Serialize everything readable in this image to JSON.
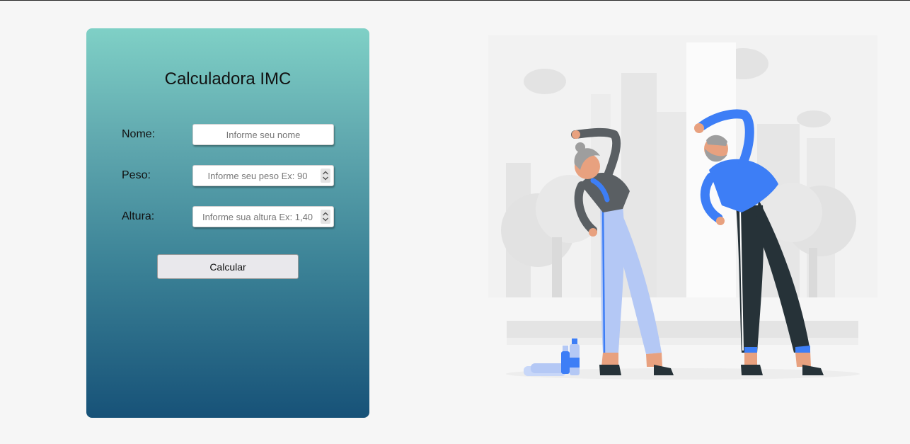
{
  "form": {
    "title": "Calculadora IMC",
    "name_label": "Nome:",
    "name_placeholder": "Informe seu nome",
    "weight_label": "Peso:",
    "weight_placeholder": "Informe seu peso Ex: 90",
    "height_label": "Altura:",
    "height_placeholder": "Informe sua altura Ex: 1,40",
    "submit_label": "Calcular"
  },
  "colors": {
    "gradient_top": "#7fd0c6",
    "gradient_bottom": "#175278",
    "page_background": "#f6f6f6",
    "accent_blue": "#3d7ef6",
    "pants_light": "#b4c8f5",
    "dark_clothing": "#263238"
  },
  "icons": {
    "spinner": "spin-arrows-icon"
  },
  "illustration": {
    "subject": "elderly couple stretching in park"
  }
}
